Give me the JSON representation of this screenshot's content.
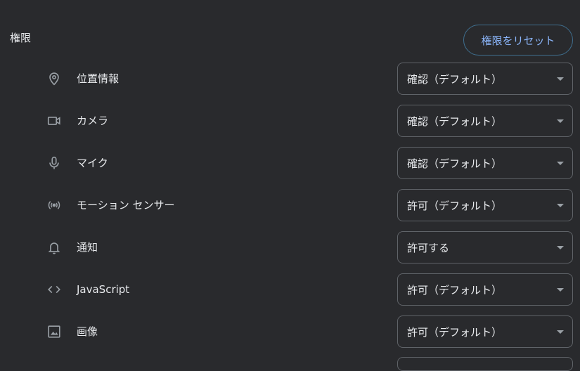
{
  "section": {
    "title": "権限",
    "reset_label": "権限をリセット"
  },
  "permissions": [
    {
      "label": "位置情報",
      "icon": "location-pin-icon",
      "value": "確認（デフォルト）"
    },
    {
      "label": "カメラ",
      "icon": "camera-icon",
      "value": "確認（デフォルト）"
    },
    {
      "label": "マイク",
      "icon": "microphone-icon",
      "value": "確認（デフォルト）"
    },
    {
      "label": "モーション センサー",
      "icon": "sensors-icon",
      "value": "許可（デフォルト）"
    },
    {
      "label": "通知",
      "icon": "bell-icon",
      "value": "許可する"
    },
    {
      "label": "JavaScript",
      "icon": "code-icon",
      "value": "許可（デフォルト）"
    },
    {
      "label": "画像",
      "icon": "image-icon",
      "value": "許可（デフォルト）"
    }
  ],
  "colors": {
    "background": "#292a2d",
    "text": "#e8eaed",
    "accent": "#8ab4f8",
    "icon": "#9aa0a6",
    "border": "#5f6368"
  }
}
